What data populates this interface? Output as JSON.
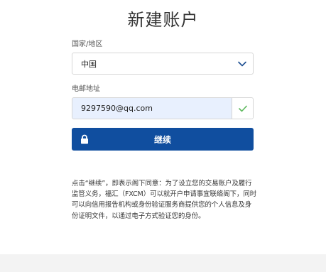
{
  "page": {
    "title": "新建账户"
  },
  "form": {
    "country_label": "国家/地区",
    "country_value": "中国",
    "email_label": "电邮地址",
    "email_value": "9297590@qq.com",
    "continue_label": "继续"
  },
  "disclaimer": {
    "text": "点击“继续”，即表示阁下同意：为了设立您的交易账户及履行监管义务，福汇（FXCM）可以就开户申请事宜联络阁下，同时可以向信用报告机构或身份验证服务商提供您的个人信息及身份证明文件，以通过电子方式验证您的身份。"
  },
  "icons": {
    "country_chevron": "chevron-down-icon",
    "email_valid": "checkmark-icon",
    "continue_lock": "lock-icon"
  },
  "colors": {
    "primary_button": "#104e9f",
    "chevron": "#1d4f91",
    "valid_check": "#5cb85c",
    "autofill_bg": "#e8f0fe"
  }
}
